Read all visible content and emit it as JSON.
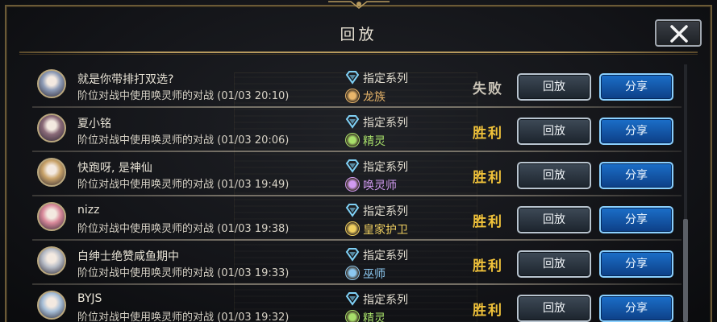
{
  "dialog": {
    "title": "回放",
    "close_icon": "close-x-icon"
  },
  "colors": {
    "win": "#f0c23a",
    "loss": "#c9c3b6",
    "share_btn": "#1567c4",
    "replay_btn": "#2c3540",
    "frame_gold": "#b79a5e"
  },
  "replays": [
    {
      "name": "就是你带排打双选?",
      "desc": "阶位对战中使用唤灵师的对战 (01/03 20:10)",
      "mode": "指定系列",
      "class": "龙族",
      "class_color": "#e8b56a",
      "class_icon": "dragon-icon",
      "avatar_hue": "#8d9bb6",
      "result": "失败",
      "result_type": "loss",
      "replay_label": "回放",
      "share_label": "分享"
    },
    {
      "name": "夏小铭",
      "desc": "阶位对战中使用唤灵师的对战 (01/03 20:06)",
      "mode": "指定系列",
      "class": "精灵",
      "class_color": "#a8e06a",
      "class_icon": "leaf-icon",
      "avatar_hue": "#8a6a78",
      "result": "胜利",
      "result_type": "win",
      "replay_label": "回放",
      "share_label": "分享"
    },
    {
      "name": "快跑呀, 是神仙",
      "desc": "阶位对战中使用唤灵师的对战 (01/03 19:49)",
      "mode": "指定系列",
      "class": "唤灵师",
      "class_color": "#d19af0",
      "class_icon": "skull-icon",
      "avatar_hue": "#c9a36a",
      "result": "胜利",
      "result_type": "win",
      "replay_label": "回放",
      "share_label": "分享"
    },
    {
      "name": "nizz",
      "desc": "阶位对战中使用唤灵师的对战 (01/03 19:38)",
      "mode": "指定系列",
      "class": "皇家护卫",
      "class_color": "#f0d060",
      "class_icon": "crown-icon",
      "avatar_hue": "#d9899a",
      "result": "胜利",
      "result_type": "win",
      "replay_label": "回放",
      "share_label": "分享"
    },
    {
      "name": "白绅士绝赞咸鱼期中",
      "desc": "阶位对战中使用唤灵师的对战 (01/03 19:33)",
      "mode": "指定系列",
      "class": "巫师",
      "class_color": "#8cc8f0",
      "class_icon": "orb-icon",
      "avatar_hue": "#b7bcc6",
      "result": "胜利",
      "result_type": "win",
      "replay_label": "回放",
      "share_label": "分享"
    },
    {
      "name": "BYJS",
      "desc": "阶位对战中使用唤灵师的对战 (01/03 19:32)",
      "mode": "指定系列",
      "class": "精灵",
      "class_color": "#a8e06a",
      "class_icon": "leaf-icon",
      "avatar_hue": "#a7bfd8",
      "result": "胜利",
      "result_type": "win",
      "replay_label": "回放",
      "share_label": "分享"
    }
  ]
}
